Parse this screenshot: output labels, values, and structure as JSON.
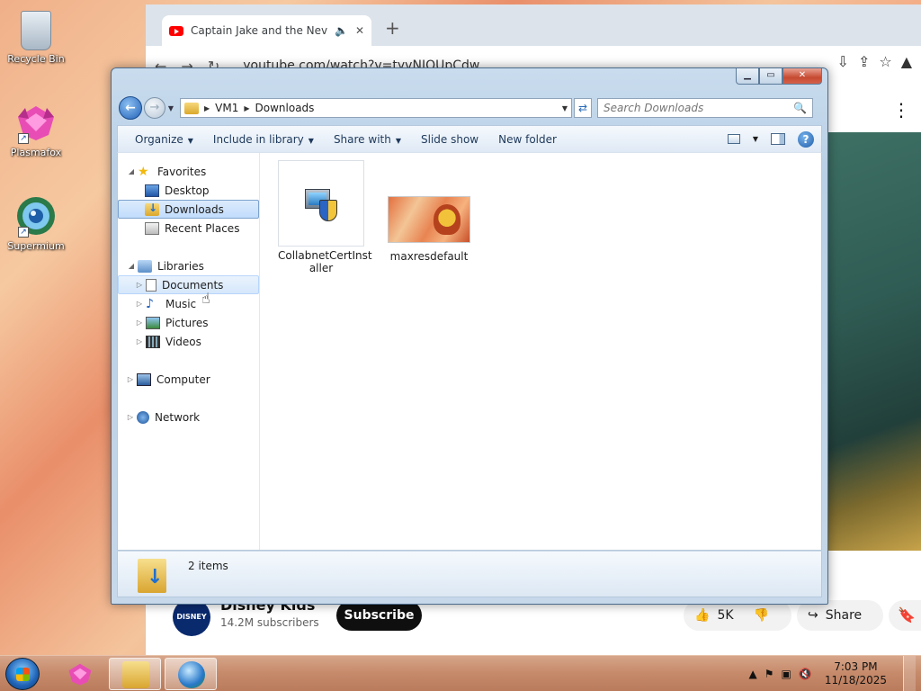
{
  "desktop": {
    "icons": [
      {
        "label": "Recycle Bin",
        "icon": "recycle-bin-icon"
      },
      {
        "label": "Plasmafox",
        "icon": "plasmafox-icon"
      },
      {
        "label": "Supermium",
        "icon": "supermium-icon"
      }
    ]
  },
  "browser": {
    "tab_title": "Captain Jake and the Never",
    "url": "youtube.com/watch?v=tyvNJOUpCdw",
    "channel_name": "Disney Kids",
    "avatar_text": "DISNEY KIDS",
    "subscribers": "14.2M subscribers",
    "subscribe_label": "Subscribe",
    "like_count": "5K",
    "share_label": "Share"
  },
  "explorer": {
    "breadcrumb": [
      "VM1",
      "Downloads"
    ],
    "search_placeholder": "Search Downloads",
    "toolbar": {
      "organize": "Organize",
      "include_in_library": "Include in library",
      "share_with": "Share with",
      "slide_show": "Slide show",
      "new_folder": "New folder"
    },
    "nav": {
      "favorites": "Favorites",
      "desktop": "Desktop",
      "downloads": "Downloads",
      "recent_places": "Recent Places",
      "libraries": "Libraries",
      "documents": "Documents",
      "music": "Music",
      "pictures": "Pictures",
      "videos": "Videos",
      "computer": "Computer",
      "network": "Network"
    },
    "files": [
      {
        "name": "CollabnetCertInst aller",
        "type": "installer"
      },
      {
        "name": "maxresdefault",
        "type": "image"
      }
    ],
    "status": "2 items"
  },
  "taskbar": {
    "time": "7:03 PM",
    "date": "11/18/2025"
  },
  "colors": {
    "selection": "#c1dcfc",
    "accent": "#1e395b",
    "youtube_red": "#ff0000"
  }
}
